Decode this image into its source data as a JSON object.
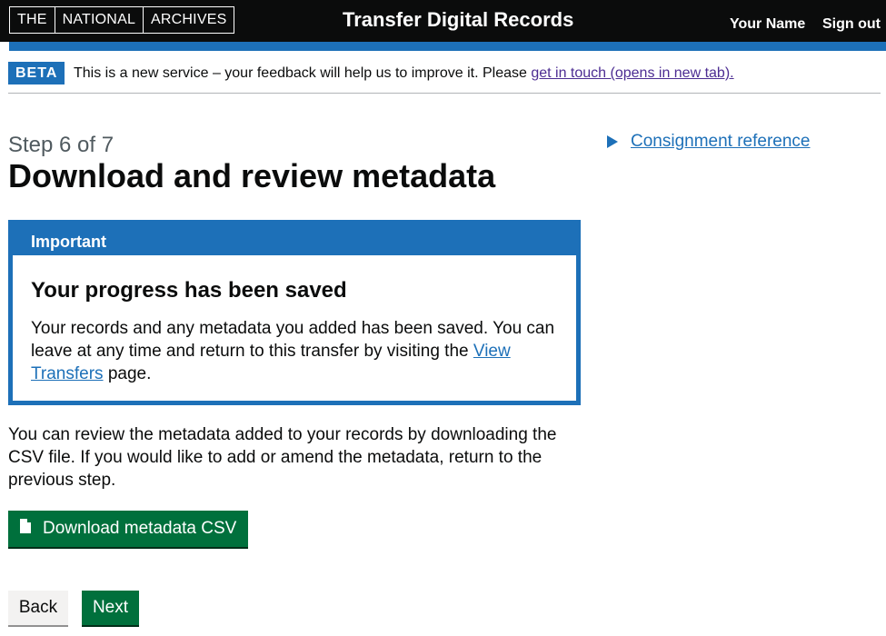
{
  "header": {
    "logo": [
      "THE",
      "NATIONAL",
      "ARCHIVES"
    ],
    "service_name": "Transfer Digital Records",
    "user_name": "Your Name",
    "sign_out": "Sign out"
  },
  "phase_banner": {
    "tag": "BETA",
    "text": "This is a new service – your feedback will help us to improve it. Please ",
    "link": "get in touch (opens in new tab)."
  },
  "page": {
    "caption": "Step 6 of 7",
    "title": "Download and review metadata"
  },
  "important": {
    "title": "Important",
    "heading": "Your progress has been saved",
    "body_before": "Your records and any metadata you added has been saved. You can leave at any time and return to this transfer by visiting the ",
    "link": "View Transfers",
    "body_after": " page."
  },
  "body_text": "You can review the metadata added to your records by downloading the CSV file. If you would like to add or amend the metadata, return to the previous step.",
  "buttons": {
    "download": "Download metadata CSV",
    "back": "Back",
    "next": "Next"
  },
  "details": {
    "summary": "Consignment reference"
  },
  "colors": {
    "header": "#0b0c0c",
    "brand_blue": "#1d70b8",
    "button_green": "#00703c",
    "visited_link": "#4c2c92"
  }
}
